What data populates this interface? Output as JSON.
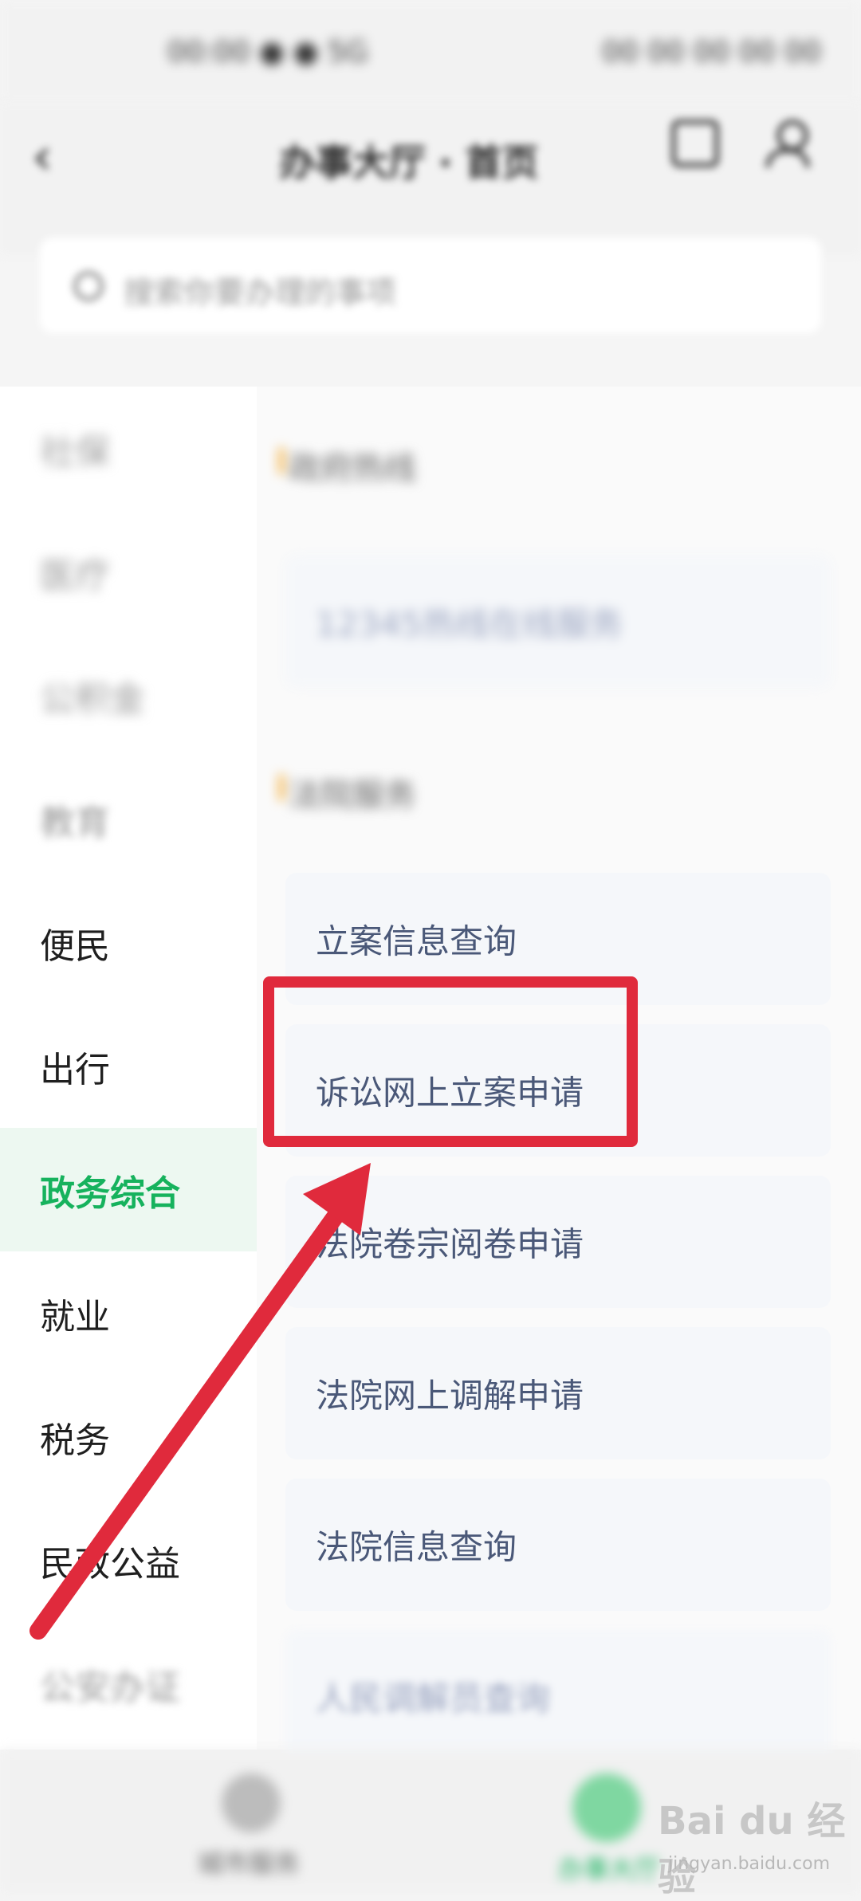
{
  "status_bar": {
    "left": "00:00 ● ● 5G",
    "right": "00 00 00 00 00"
  },
  "header": {
    "title": "办事大厅 · 首页"
  },
  "search": {
    "placeholder": "搜索你要办理的事项"
  },
  "sidebar": {
    "items": [
      {
        "label": "社保",
        "state": "faded"
      },
      {
        "label": "医疗",
        "state": "faded"
      },
      {
        "label": "公积金",
        "state": "faded"
      },
      {
        "label": "教育",
        "state": "faded"
      },
      {
        "label": "便民",
        "state": "normal"
      },
      {
        "label": "出行",
        "state": "normal"
      },
      {
        "label": "政务综合",
        "state": "active"
      },
      {
        "label": "就业",
        "state": "normal"
      },
      {
        "label": "税务",
        "state": "normal"
      },
      {
        "label": "民政公益",
        "state": "normal"
      },
      {
        "label": "公安办证",
        "state": "faded"
      }
    ]
  },
  "main": {
    "sections": [
      {
        "title": "政府热线"
      },
      {
        "title": "法院服务"
      }
    ],
    "cards": [
      {
        "label": "12345热线在线服务"
      },
      {
        "label": "立案信息查询"
      },
      {
        "label": "诉讼网上立案申请"
      },
      {
        "label": "法院卷宗阅卷申请"
      },
      {
        "label": "法院网上调解申请"
      },
      {
        "label": "法院信息查询"
      },
      {
        "label": "人民调解员查询"
      }
    ]
  },
  "bottom_nav": {
    "left_label": "城市服务",
    "right_label": "办事大厅"
  },
  "watermark": {
    "text": "Bai du 经验",
    "sub": "jingyan.baidu.com"
  },
  "colors": {
    "accent": "#16b25d",
    "annotation": "#e02a3c",
    "card_text": "#4a5878",
    "section_marker": "#f5a623"
  },
  "icons": {
    "back": "chevron-left-icon",
    "grid": "grid-icon",
    "user": "person-icon",
    "search": "search-icon"
  }
}
